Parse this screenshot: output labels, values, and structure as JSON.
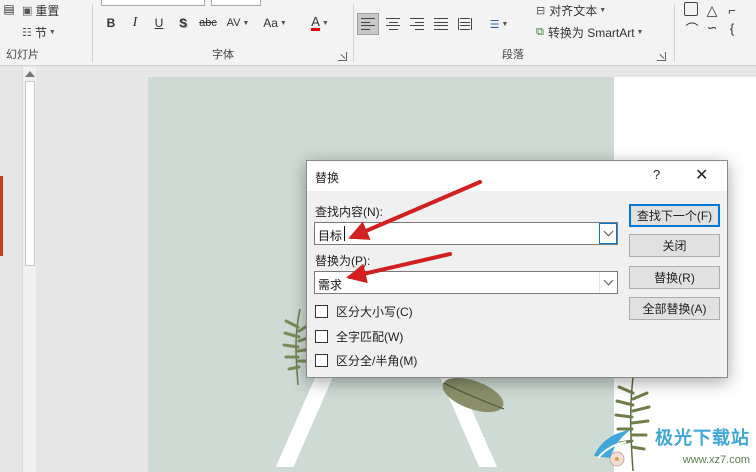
{
  "ribbon": {
    "slides_group": {
      "reset_label": "重置",
      "section_label": "节",
      "group_label": "幻灯片"
    },
    "font_group": {
      "bold": "B",
      "italic": "I",
      "underline": "U",
      "shadow": "S",
      "strikethrough": "abc",
      "spacing": "AV",
      "change_case": "Aa",
      "font_color": "A",
      "group_label": "字体"
    },
    "paragraph_group": {
      "align_text_label": "对齐文本",
      "convert_smartart_label": "转换为 SmartArt",
      "group_label": "段落"
    }
  },
  "dialog": {
    "title": "替换",
    "help_glyph": "?",
    "close_glyph": "✕",
    "find_label": "查找内容(N):",
    "find_value": "目标",
    "replace_label": "替换为(P):",
    "replace_value": "需求",
    "options": [
      {
        "label": "区分大小写(C)",
        "checked": false
      },
      {
        "label": "全字匹配(W)",
        "checked": false
      },
      {
        "label": "区分全/半角(M)",
        "checked": false
      }
    ],
    "buttons": {
      "find_next": "查找下一个(F)",
      "close": "关闭",
      "replace": "替换(R)",
      "replace_all": "全部替换(A)"
    }
  },
  "watermark": {
    "text": "极光下载站",
    "url": "www.xz7.com"
  },
  "colors": {
    "arrow": "#d21f1f",
    "slide_background": "#cddbd4",
    "default_button_border": "#0078d7",
    "thumb_accent": "#c43e1c"
  }
}
